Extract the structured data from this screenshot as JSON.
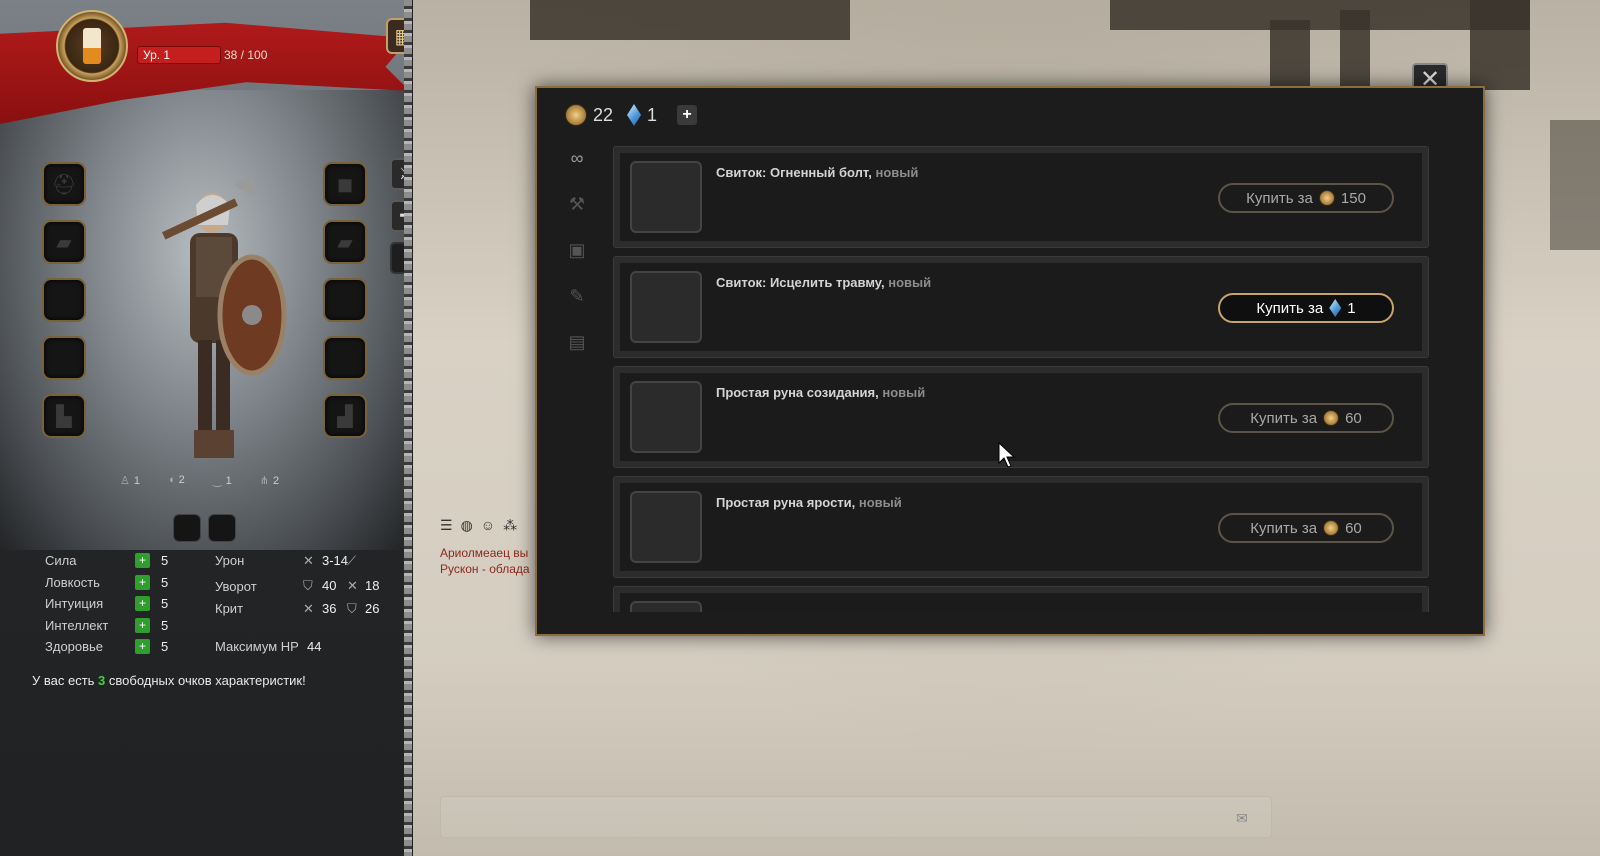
{
  "player": {
    "level_label": "Ур. 1",
    "xp": "38 / 100"
  },
  "equipment_slots_left": [
    "helmet",
    "shoulders",
    "ring",
    "belt",
    "boots"
  ],
  "equipment_slots_right": [
    "amulet",
    "gloves",
    "ring",
    "weapon",
    "offhand"
  ],
  "armor_stats": [
    {
      "icon": "head-armor-icon",
      "value": "1"
    },
    {
      "icon": "body-armor-icon",
      "value": "2"
    },
    {
      "icon": "waist-armor-icon",
      "value": "1"
    },
    {
      "icon": "legs-armor-icon",
      "value": "2"
    }
  ],
  "attributes": [
    {
      "label": "Сила",
      "value": "5"
    },
    {
      "label": "Ловкость",
      "value": "5"
    },
    {
      "label": "Интуиция",
      "value": "5"
    },
    {
      "label": "Интеллект",
      "value": "5"
    },
    {
      "label": "Здоровье",
      "value": "5"
    }
  ],
  "combat": {
    "damage_label": "Урон",
    "damage_value": "3-14",
    "dodge_label": "Уворот",
    "dodge_value": "40",
    "dodge_value2": "18",
    "crit_label": "Крит",
    "crit_value": "36",
    "crit_value2": "26",
    "maxhp_label": "Максимум HP",
    "maxhp_value": "44"
  },
  "free_points": {
    "prefix": "У вас есть ",
    "count": "3",
    "suffix": " свободных очков характеристик!"
  },
  "chat": {
    "line1": "Ариолмеаец вы",
    "line2": "Рускон  - облада"
  },
  "shop": {
    "gold": "22",
    "gems": "1",
    "add_label": "+",
    "close_label": "✕",
    "items": [
      {
        "name": "Свиток: Огненный болт,",
        "tag": " новый",
        "buy_label": "Купить за",
        "price": "150",
        "currency": "gold",
        "primary": false
      },
      {
        "name": "Свиток: Исцелить травму,",
        "tag": " новый",
        "buy_label": "Купить за",
        "price": "1",
        "currency": "gem",
        "primary": true
      },
      {
        "name": "Простая руна созидания,",
        "tag": " новый",
        "buy_label": "Купить за",
        "price": "60",
        "currency": "gold",
        "primary": false
      },
      {
        "name": "Простая руна ярости,",
        "tag": " новый",
        "buy_label": "Купить за",
        "price": "60",
        "currency": "gold",
        "primary": false
      }
    ]
  },
  "colors": {
    "accent_gold": "#c9a468",
    "banner_red": "#b31b1b",
    "plus_green": "#2f9e2f"
  }
}
